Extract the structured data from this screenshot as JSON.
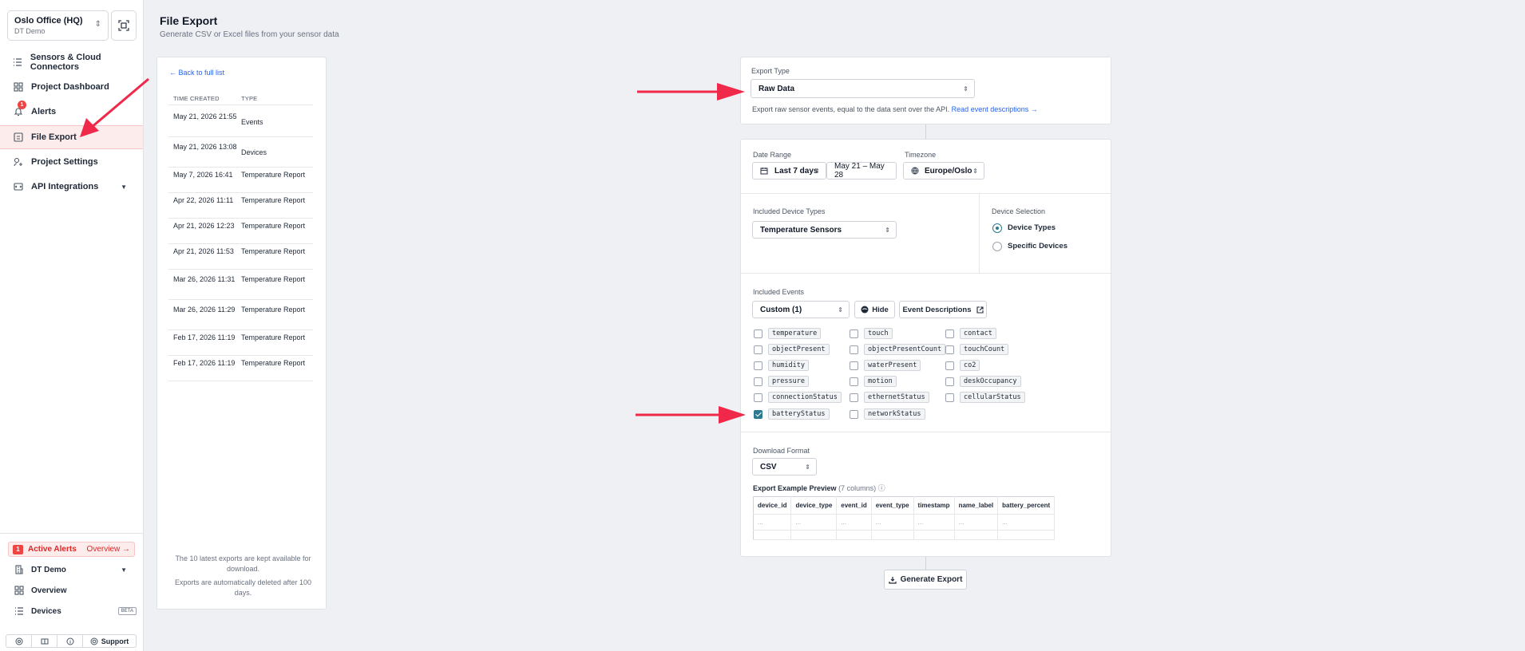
{
  "sidebar": {
    "org_name": "Oslo Office (HQ)",
    "org_sub": "DT Demo",
    "items": [
      {
        "label": "Sensors & Cloud Connectors",
        "icon": "list-icon"
      },
      {
        "label": "Project Dashboard",
        "icon": "dashboard-icon"
      },
      {
        "label": "Alerts",
        "icon": "bell-icon",
        "badge": "1"
      },
      {
        "label": "File Export",
        "icon": "file-export-icon",
        "active": true
      },
      {
        "label": "Project Settings",
        "icon": "settings-icon"
      },
      {
        "label": "API Integrations",
        "icon": "api-icon"
      }
    ],
    "active_alerts": {
      "badge": "1",
      "label": "Active Alerts",
      "link": "Overview →"
    },
    "bottom": {
      "org": "DT Demo",
      "overview": "Overview",
      "devices": "Devices",
      "beta": "BETA"
    },
    "support": "Support"
  },
  "page": {
    "title": "File Export",
    "subtitle": "Generate CSV or Excel files from your sensor data"
  },
  "history": {
    "back": "Back to full list",
    "col_time": "TIME CREATED",
    "col_type": "TYPE",
    "rows": [
      {
        "time": "May 21, 2026 21:55",
        "type": "Events"
      },
      {
        "time": "May 21, 2026 13:08",
        "type": "Devices"
      },
      {
        "time": "May 7, 2026 16:41",
        "type": "Temperature Report"
      },
      {
        "time": "Apr 22, 2026 11:11",
        "type": "Temperature Report"
      },
      {
        "time": "Apr 21, 2026 12:23",
        "type": "Temperature Report"
      },
      {
        "time": "Apr 21, 2026 11:53",
        "type": "Temperature Report"
      },
      {
        "time": "Mar 26, 2026 11:31",
        "type": "Temperature Report"
      },
      {
        "time": "Mar 26, 2026 11:29",
        "type": "Temperature Report"
      },
      {
        "time": "Feb 17, 2026 11:19",
        "type": "Temperature Report"
      },
      {
        "time": "Feb 17, 2026 11:19",
        "type": "Temperature Report"
      }
    ],
    "note1": "The 10 latest exports are kept available for download.",
    "note2": "Exports are automatically deleted after 100 days."
  },
  "export_type": {
    "label": "Export Type",
    "value": "Raw Data",
    "description": "Export raw sensor events, equal to the data sent over the API.",
    "read_link": "Read event descriptions →"
  },
  "filters": {
    "date_range_label": "Date Range",
    "date_range_value": "Last 7 days",
    "date_range_span": "May 21 – May 28",
    "timezone_label": "Timezone",
    "timezone_value": "Europe/Oslo",
    "device_types_label": "Included Device Types",
    "device_types_value": "Temperature Sensors",
    "device_selection_label": "Device Selection",
    "device_selection_options": [
      "Device Types",
      "Specific Devices"
    ],
    "events_label": "Included Events",
    "events_value": "Custom (1)",
    "hide_label": "Hide",
    "event_desc_label": "Event Descriptions",
    "events": [
      [
        "temperature",
        "touch",
        "contact"
      ],
      [
        "objectPresent",
        "objectPresentCount",
        "touchCount"
      ],
      [
        "humidity",
        "waterPresent",
        "co2"
      ],
      [
        "pressure",
        "motion",
        "deskOccupancy"
      ],
      [
        "connectionStatus",
        "ethernetStatus",
        "cellularStatus"
      ],
      [
        "batteryStatus",
        "networkStatus"
      ]
    ],
    "checked_event": "batteryStatus"
  },
  "download": {
    "format_label": "Download Format",
    "format_value": "CSV",
    "preview_label": "Export Example Preview",
    "preview_count": "(7 columns)",
    "columns": [
      "device_id",
      "device_type",
      "event_id",
      "event_type",
      "timestamp",
      "name_label",
      "battery_percent"
    ],
    "placeholder": "..."
  },
  "generate_label": "Generate Export",
  "colors": {
    "accent": "#2c7a8e",
    "alert": "#ef4444",
    "arrow": "#f0284a",
    "link": "#2563eb"
  }
}
